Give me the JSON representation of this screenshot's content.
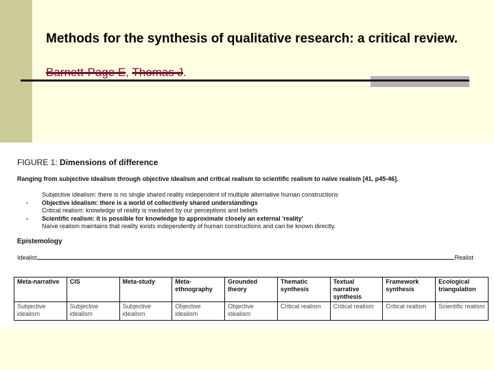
{
  "slide": {
    "title": "Methods for the synthesis of qualitative research: a critical review.",
    "authors": [
      "Barnett-Page E",
      "Thomas J"
    ],
    "author_sep": ", ",
    "author_end": "."
  },
  "figure": {
    "label": "FIGURE 1:",
    "title": "Dimensions of difference",
    "range": "Ranging from subjective idealism through objective idealism and critical realism to scientific realism to naïve realism [41, p45-46].",
    "items": [
      {
        "dash": "",
        "text": "Subjective idealism: there is no single shared reality independent of multiple alternative human constructions",
        "bold": false
      },
      {
        "dash": "-",
        "text": "Objective idealism: there is a world of collectively shared understandings",
        "bold": true
      },
      {
        "dash": "",
        "text": "Critical realism: knowledge of reality is mediated by our perceptions and beliefs",
        "bold": false
      },
      {
        "dash": "-",
        "text": "Scientific realism: it is possible for knowledge to approximate closely an external 'reality'",
        "bold": true
      },
      {
        "dash": "",
        "text": "Naïve realism maintains that reality exists independently of human constructions and can be known directly.",
        "bold": false
      }
    ],
    "epistemology": "Epistemology",
    "scale_left": "Idealist",
    "scale_right": "Realist",
    "table": {
      "methods": [
        "Meta-narrative",
        "CIS",
        "Meta-study",
        "Meta-ethnography",
        "Grounded theory",
        "Thematic synthesis",
        "Textual narrative synthesis",
        "Framework synthesis",
        "Ecological triangulation"
      ],
      "epistemology": [
        "Subjective idealism",
        "Subjective idealism",
        "Subjective idealism",
        "Objective idealism",
        "Objective idealism",
        "Critical realism",
        "Critical realism",
        "Critical realism",
        "Scientific realism"
      ]
    }
  }
}
